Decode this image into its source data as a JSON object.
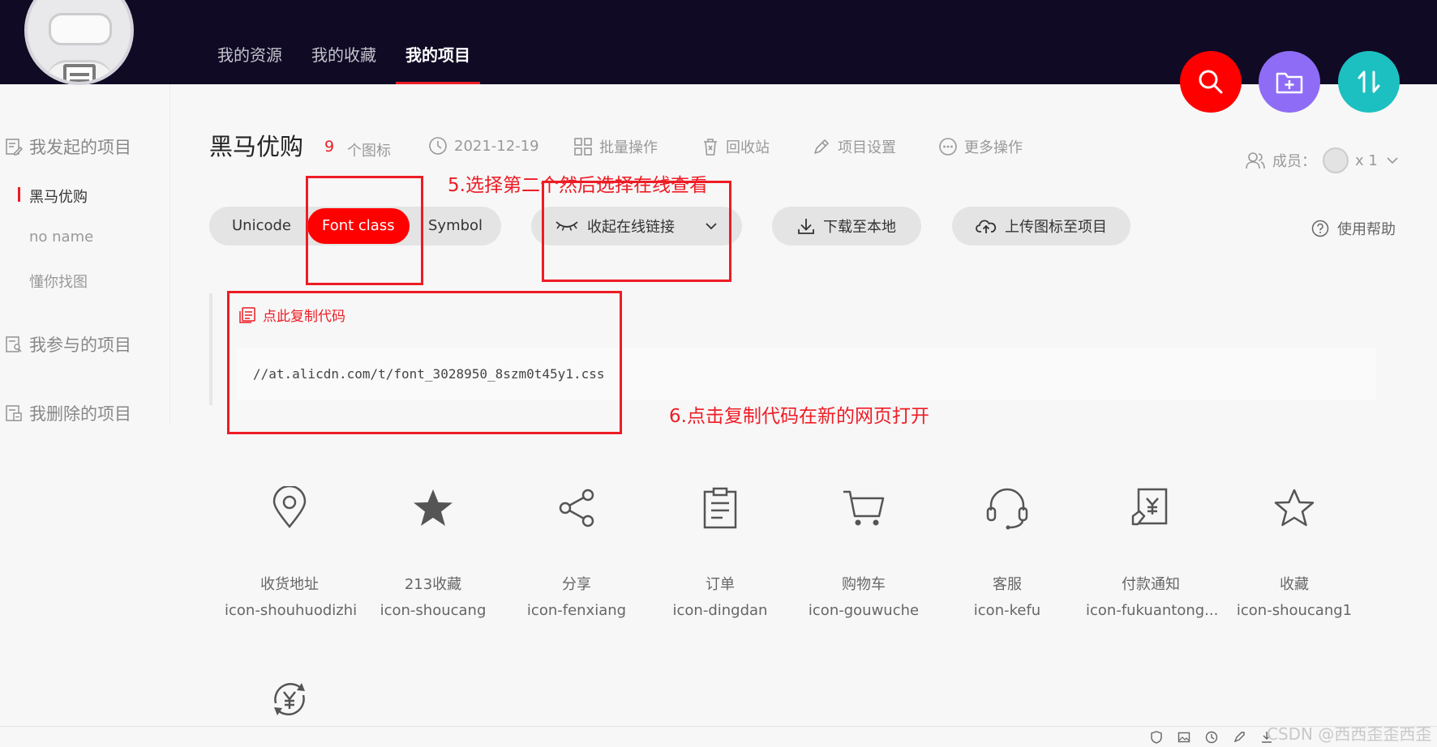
{
  "nav": {
    "items": [
      {
        "label": "我的资源"
      },
      {
        "label": "我的收藏"
      },
      {
        "label": "我的项目"
      }
    ]
  },
  "sidebar": {
    "group_started": "我发起的项目",
    "projects": [
      {
        "label": "黑马优购"
      },
      {
        "label": "no name"
      },
      {
        "label": "懂你找图"
      }
    ],
    "group_joined": "我参与的项目",
    "group_deleted": "我删除的项目"
  },
  "project": {
    "title": "黑马优购",
    "icon_count": "9",
    "icon_count_label": "个图标",
    "date": "2021-12-19",
    "batch": "批量操作",
    "recycle": "回收站",
    "settings": "项目设置",
    "more": "更多操作",
    "members_label": "成员：",
    "members_count": "x 1"
  },
  "tabs": [
    {
      "label": "Unicode"
    },
    {
      "label": "Font class"
    },
    {
      "label": "Symbol"
    }
  ],
  "actions": {
    "collapse_link": "收起在线链接",
    "download": "下载至本地",
    "upload": "上传图标至项目",
    "help": "使用帮助"
  },
  "code": {
    "copy_label": "点此复制代码",
    "url": "//at.alicdn.com/t/font_3028950_8szm0t45y1.css"
  },
  "annotations": {
    "step5": "5.选择第二个然后选择在线查看",
    "step6": "6.点击复制代码在新的网页打开"
  },
  "icons": [
    {
      "name": "收货地址",
      "code": "icon-shouhuodizhi"
    },
    {
      "name": "213收藏",
      "code": "icon-shoucang"
    },
    {
      "name": "分享",
      "code": "icon-fenxiang"
    },
    {
      "name": "订单",
      "code": "icon-dingdan"
    },
    {
      "name": "购物车",
      "code": "icon-gouwuche"
    },
    {
      "name": "客服",
      "code": "icon-kefu"
    },
    {
      "name": "付款通知",
      "code": "icon-fukuantong..."
    },
    {
      "name": "收藏",
      "code": "icon-shoucang1"
    }
  ],
  "watermark": "CSDN @西西歪歪西歪",
  "colors": {
    "brand_red": "#ee1c25",
    "topbar": "#100a25",
    "search_btn": "#ff0000",
    "folder_btn": "#8f6cf6",
    "sort_btn": "#1cc0c0"
  }
}
